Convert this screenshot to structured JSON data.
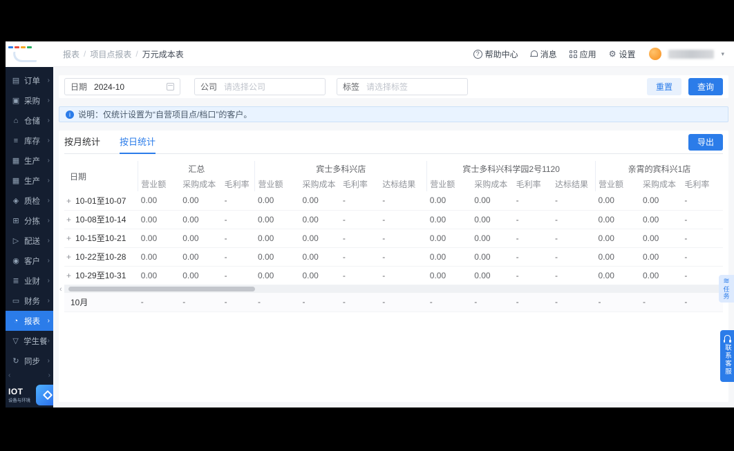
{
  "colors": {
    "accent": "#2b7ce9",
    "sidebar_bg": "#141e30",
    "notice_bg": "#e9f3ff"
  },
  "sidebar": {
    "items": [
      {
        "key": "orders",
        "label": "订单",
        "icon": "clipboard"
      },
      {
        "key": "purchasing",
        "label": "采购",
        "icon": "cart"
      },
      {
        "key": "warehousing",
        "label": "仓储",
        "icon": "warehouse"
      },
      {
        "key": "inventory",
        "label": "库存",
        "icon": "layers"
      },
      {
        "key": "production-1",
        "label": "生产",
        "icon": "factory"
      },
      {
        "key": "production-2",
        "label": "生产",
        "icon": "factory"
      },
      {
        "key": "quality",
        "label": "质检",
        "icon": "shield"
      },
      {
        "key": "sorting",
        "label": "分拣",
        "icon": "grid"
      },
      {
        "key": "delivery",
        "label": "配送",
        "icon": "truck"
      },
      {
        "key": "customers",
        "label": "客户",
        "icon": "users"
      },
      {
        "key": "biz-finance",
        "label": "业财",
        "icon": "document"
      },
      {
        "key": "finance",
        "label": "财务",
        "icon": "wallet"
      },
      {
        "key": "reports",
        "label": "报表",
        "icon": "chart",
        "active": true
      },
      {
        "key": "student-meals",
        "label": "学生餐",
        "icon": "meal"
      },
      {
        "key": "sync",
        "label": "同步",
        "icon": "sync"
      }
    ],
    "iot": {
      "title": "IOT",
      "subtitle": "设备与环境"
    }
  },
  "header": {
    "breadcrumb": [
      "报表",
      "项目点报表",
      "万元成本表"
    ],
    "help": "帮助中心",
    "messages": "消息",
    "apps": "应用",
    "settings": "设置"
  },
  "filters": {
    "date_label": "日期",
    "date_value": "2024-10",
    "company_label": "公司",
    "company_placeholder": "请选择公司",
    "tag_label": "标签",
    "tag_placeholder": "请选择标签",
    "reset_label": "重置",
    "query_label": "查询"
  },
  "notice_text": "说明：仅统计设置为“自营项目点/档口”的客户。",
  "tabs": [
    {
      "label": "按月统计",
      "active": false
    },
    {
      "label": "按日统计",
      "active": true
    }
  ],
  "export_label": "导出",
  "table": {
    "date_header": "日期",
    "groups": [
      {
        "name": "汇总",
        "cols": [
          "营业额",
          "采购成本",
          "毛利率"
        ]
      },
      {
        "name": "宾士多科兴店",
        "cols": [
          "营业额",
          "采购成本",
          "毛利率",
          "达标结果"
        ]
      },
      {
        "name": "宾士多科兴科学园2号1120",
        "cols": [
          "营业额",
          "采购成本",
          "毛利率",
          "达标结果"
        ]
      },
      {
        "name": "亲霄的宾科兴1店",
        "cols": [
          "营业额",
          "采购成本",
          "毛利率"
        ]
      }
    ],
    "rows": [
      {
        "date": "10-01至10-07",
        "values": [
          "0.00",
          "0.00",
          "-",
          "0.00",
          "0.00",
          "-",
          "-",
          "0.00",
          "0.00",
          "-",
          "-",
          "0.00",
          "0.00",
          "-"
        ]
      },
      {
        "date": "10-08至10-14",
        "values": [
          "0.00",
          "0.00",
          "-",
          "0.00",
          "0.00",
          "-",
          "-",
          "0.00",
          "0.00",
          "-",
          "-",
          "0.00",
          "0.00",
          "-"
        ]
      },
      {
        "date": "10-15至10-21",
        "values": [
          "0.00",
          "0.00",
          "-",
          "0.00",
          "0.00",
          "-",
          "-",
          "0.00",
          "0.00",
          "-",
          "-",
          "0.00",
          "0.00",
          "-"
        ]
      },
      {
        "date": "10-22至10-28",
        "values": [
          "0.00",
          "0.00",
          "-",
          "0.00",
          "0.00",
          "-",
          "-",
          "0.00",
          "0.00",
          "-",
          "-",
          "0.00",
          "0.00",
          "-"
        ]
      },
      {
        "date": "10-29至10-31",
        "values": [
          "0.00",
          "0.00",
          "-",
          "0.00",
          "0.00",
          "-",
          "-",
          "0.00",
          "0.00",
          "-",
          "-",
          "0.00",
          "0.00",
          "-"
        ]
      }
    ],
    "summary": {
      "date": "10月",
      "values": [
        "-",
        "-",
        "-",
        "-",
        "-",
        "-",
        "-",
        "-",
        "-",
        "-",
        "-",
        "-",
        "-",
        "-"
      ]
    }
  },
  "floating": {
    "task_label": "任务",
    "support_label": "联系客服"
  }
}
